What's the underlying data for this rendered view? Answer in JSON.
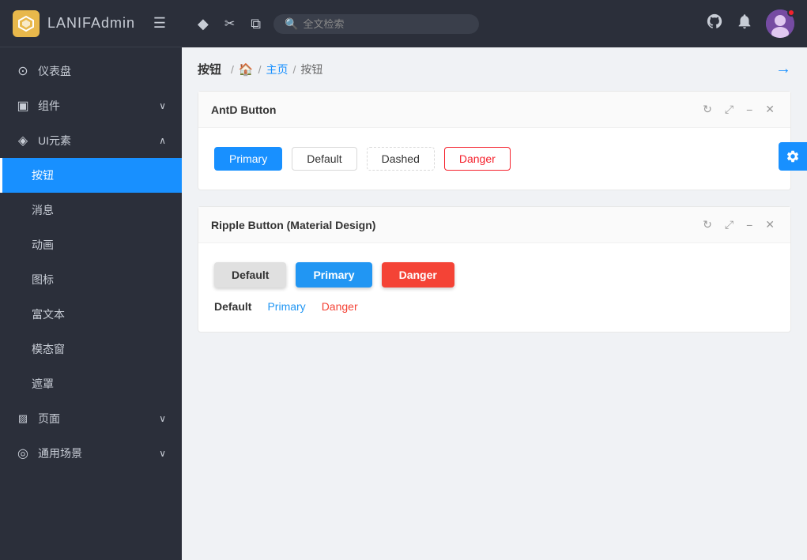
{
  "app": {
    "logo_text_bold": "LANIF",
    "logo_text_normal": "Admin"
  },
  "sidebar": {
    "items": [
      {
        "id": "dashboard",
        "label": "仪表盘",
        "icon": "⊙",
        "active": false,
        "arrow": false
      },
      {
        "id": "components",
        "label": "组件",
        "icon": "▣",
        "active": false,
        "arrow": true
      },
      {
        "id": "ui-elements",
        "label": "UI元素",
        "icon": "◈",
        "active": false,
        "arrow": true,
        "expanded": true
      },
      {
        "id": "buttons",
        "label": "按钮",
        "icon": "",
        "active": true,
        "arrow": false,
        "child": true
      },
      {
        "id": "messages",
        "label": "消息",
        "icon": "",
        "active": false,
        "arrow": false,
        "child": true
      },
      {
        "id": "animations",
        "label": "动画",
        "icon": "",
        "active": false,
        "arrow": false,
        "child": true
      },
      {
        "id": "icons",
        "label": "图标",
        "icon": "",
        "active": false,
        "arrow": false,
        "child": true
      },
      {
        "id": "richtext",
        "label": "富文本",
        "icon": "",
        "active": false,
        "arrow": false,
        "child": true
      },
      {
        "id": "modals",
        "label": "模态窗",
        "icon": "",
        "active": false,
        "arrow": false,
        "child": true
      },
      {
        "id": "overlays",
        "label": "遮罩",
        "icon": "",
        "active": false,
        "arrow": false,
        "child": true
      },
      {
        "id": "pages",
        "label": "页面",
        "icon": "▨",
        "active": false,
        "arrow": true
      },
      {
        "id": "scenarios",
        "label": "通用场景",
        "icon": "◎",
        "active": false,
        "arrow": true
      }
    ]
  },
  "topbar": {
    "search_placeholder": "全文检索",
    "icons": [
      "diamond",
      "scissors",
      "copy"
    ]
  },
  "breadcrumb": {
    "page_title": "按钮",
    "home_icon": "🏠",
    "items": [
      {
        "label": "主页",
        "link": true
      },
      {
        "label": "按钮",
        "link": false
      }
    ]
  },
  "antd_card": {
    "title": "AntD Button",
    "buttons": [
      {
        "label": "Primary",
        "type": "primary"
      },
      {
        "label": "Default",
        "type": "default"
      },
      {
        "label": "Dashed",
        "type": "dashed"
      },
      {
        "label": "Danger",
        "type": "danger"
      }
    ],
    "actions": [
      "refresh",
      "expand",
      "minimize",
      "close"
    ]
  },
  "ripple_card": {
    "title": "Ripple Button (Material Design)",
    "filled_buttons": [
      {
        "label": "Default",
        "type": "default"
      },
      {
        "label": "Primary",
        "type": "primary"
      },
      {
        "label": "Danger",
        "type": "danger"
      }
    ],
    "text_buttons": [
      {
        "label": "Default",
        "type": "default"
      },
      {
        "label": "Primary",
        "type": "primary"
      },
      {
        "label": "Danger",
        "type": "danger"
      }
    ],
    "actions": [
      "refresh",
      "expand",
      "minimize",
      "close"
    ]
  },
  "settings_icon": "⚙"
}
